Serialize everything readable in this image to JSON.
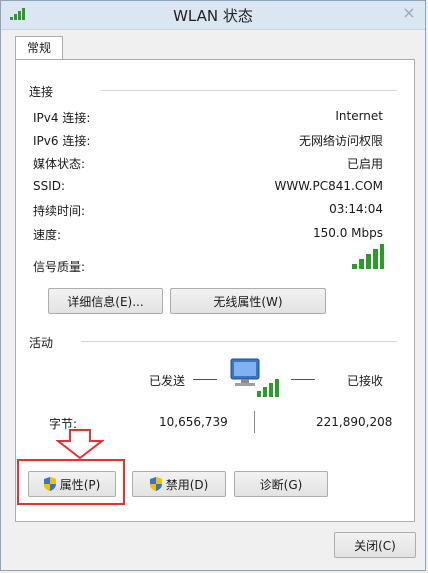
{
  "window": {
    "title": "WLAN 状态",
    "close_glyph": "×"
  },
  "tabs": [
    {
      "label": "常规"
    }
  ],
  "connection": {
    "section_title": "连接",
    "rows": [
      {
        "label": "IPv4 连接:",
        "value": "Internet"
      },
      {
        "label": "IPv6 连接:",
        "value": "无网络访问权限"
      },
      {
        "label": "媒体状态:",
        "value": "已启用"
      },
      {
        "label": "SSID:",
        "value": "WWW.PC841.COM"
      },
      {
        "label": "持续时间:",
        "value": "03:14:04"
      },
      {
        "label": "速度:",
        "value": "150.0 Mbps"
      },
      {
        "label": "信号质量:",
        "value_icon": "signal-strength-icon",
        "signal_bars": 5
      }
    ],
    "details_button": "详细信息(E)...",
    "wireless_props_button": "无线属性(W)"
  },
  "activity": {
    "section_title": "活动",
    "sent_label": "已发送",
    "received_label": "已接收",
    "bytes_label": "字节:",
    "bytes_sent": "10,656,739",
    "bytes_received": "221,890,208",
    "network_icon": "network-computer-icon"
  },
  "bottom_buttons": {
    "properties": "属性(P)",
    "disable": "禁用(D)",
    "diagnose": "诊断(G)"
  },
  "footer": {
    "close_button": "关闭(C)"
  },
  "colors": {
    "highlight": "#e53333",
    "signal": "#2e9a2e",
    "title_bar": "#dbe6f3"
  }
}
